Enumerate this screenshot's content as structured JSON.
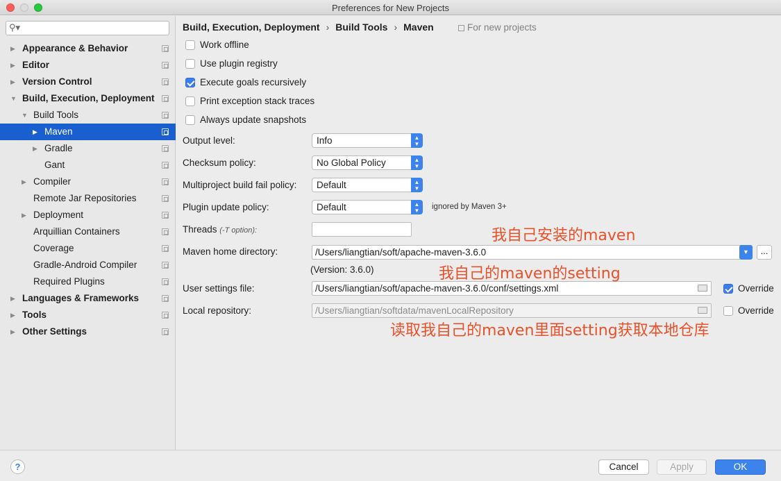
{
  "window": {
    "title": "Preferences for New Projects"
  },
  "sidebar": {
    "items": [
      {
        "label": "Appearance & Behavior",
        "bold": true,
        "level": 0,
        "arrow": "▶"
      },
      {
        "label": "Editor",
        "bold": true,
        "level": 0,
        "arrow": "▶"
      },
      {
        "label": "Version Control",
        "bold": true,
        "level": 0,
        "arrow": "▶"
      },
      {
        "label": "Build, Execution, Deployment",
        "bold": true,
        "level": 0,
        "arrow": "▼"
      },
      {
        "label": "Build Tools",
        "bold": false,
        "level": 1,
        "arrow": "▼"
      },
      {
        "label": "Maven",
        "bold": false,
        "level": 2,
        "arrow": "▶",
        "selected": true
      },
      {
        "label": "Gradle",
        "bold": false,
        "level": 2,
        "arrow": "▶"
      },
      {
        "label": "Gant",
        "bold": false,
        "level": 2,
        "arrow": ""
      },
      {
        "label": "Compiler",
        "bold": false,
        "level": 1,
        "arrow": "▶"
      },
      {
        "label": "Remote Jar Repositories",
        "bold": false,
        "level": 1,
        "arrow": ""
      },
      {
        "label": "Deployment",
        "bold": false,
        "level": 1,
        "arrow": "▶"
      },
      {
        "label": "Arquillian Containers",
        "bold": false,
        "level": 1,
        "arrow": ""
      },
      {
        "label": "Coverage",
        "bold": false,
        "level": 1,
        "arrow": ""
      },
      {
        "label": "Gradle-Android Compiler",
        "bold": false,
        "level": 1,
        "arrow": ""
      },
      {
        "label": "Required Plugins",
        "bold": false,
        "level": 1,
        "arrow": ""
      },
      {
        "label": "Languages & Frameworks",
        "bold": true,
        "level": 0,
        "arrow": "▶"
      },
      {
        "label": "Tools",
        "bold": true,
        "level": 0,
        "arrow": "▶"
      },
      {
        "label": "Other Settings",
        "bold": true,
        "level": 0,
        "arrow": "▶"
      }
    ]
  },
  "breadcrumb": {
    "part1": "Build, Execution, Deployment",
    "sep": "›",
    "part2": "Build Tools",
    "part3": "Maven",
    "for_new": "For new projects"
  },
  "checkboxes": {
    "work_offline": {
      "label": "Work offline",
      "checked": false
    },
    "use_plugin_registry": {
      "label": "Use plugin registry",
      "checked": false
    },
    "execute_goals": {
      "label": "Execute goals recursively",
      "checked": true
    },
    "print_exception": {
      "label": "Print exception stack traces",
      "checked": false
    },
    "always_update": {
      "label": "Always update snapshots",
      "checked": false
    }
  },
  "fields": {
    "output_level": {
      "label": "Output level:",
      "value": "Info"
    },
    "checksum_policy": {
      "label": "Checksum policy:",
      "value": "No Global Policy"
    },
    "multiproject_policy": {
      "label": "Multiproject build fail policy:",
      "value": "Default"
    },
    "plugin_update": {
      "label": "Plugin update policy:",
      "value": "Default",
      "hint": "ignored by Maven 3+"
    },
    "threads": {
      "label": "Threads",
      "sub": "(-T option):",
      "value": ""
    },
    "maven_home": {
      "label": "Maven home directory:",
      "value": "/Users/liangtian/soft/apache-maven-3.6.0",
      "more": "..."
    },
    "version": "(Version: 3.6.0)",
    "user_settings": {
      "label": "User settings file:",
      "value": "/Users/liangtian/soft/apache-maven-3.6.0/conf/settings.xml",
      "override_label": "Override",
      "override_checked": true
    },
    "local_repo": {
      "label": "Local repository:",
      "value": "/Users/liangtian/softdata/mavenLocalRepository",
      "override_label": "Override",
      "override_checked": false
    }
  },
  "annotations": {
    "a1": "我自己安装的maven",
    "a2": "我自己的maven的setting",
    "a3": "读取我自己的maven里面setting获取本地仓库"
  },
  "footer": {
    "help": "?",
    "cancel": "Cancel",
    "apply": "Apply",
    "ok": "OK"
  },
  "colors": {
    "accent": "#3d83ec",
    "selection": "#1a5fcf",
    "annotation": "#e8512a"
  }
}
